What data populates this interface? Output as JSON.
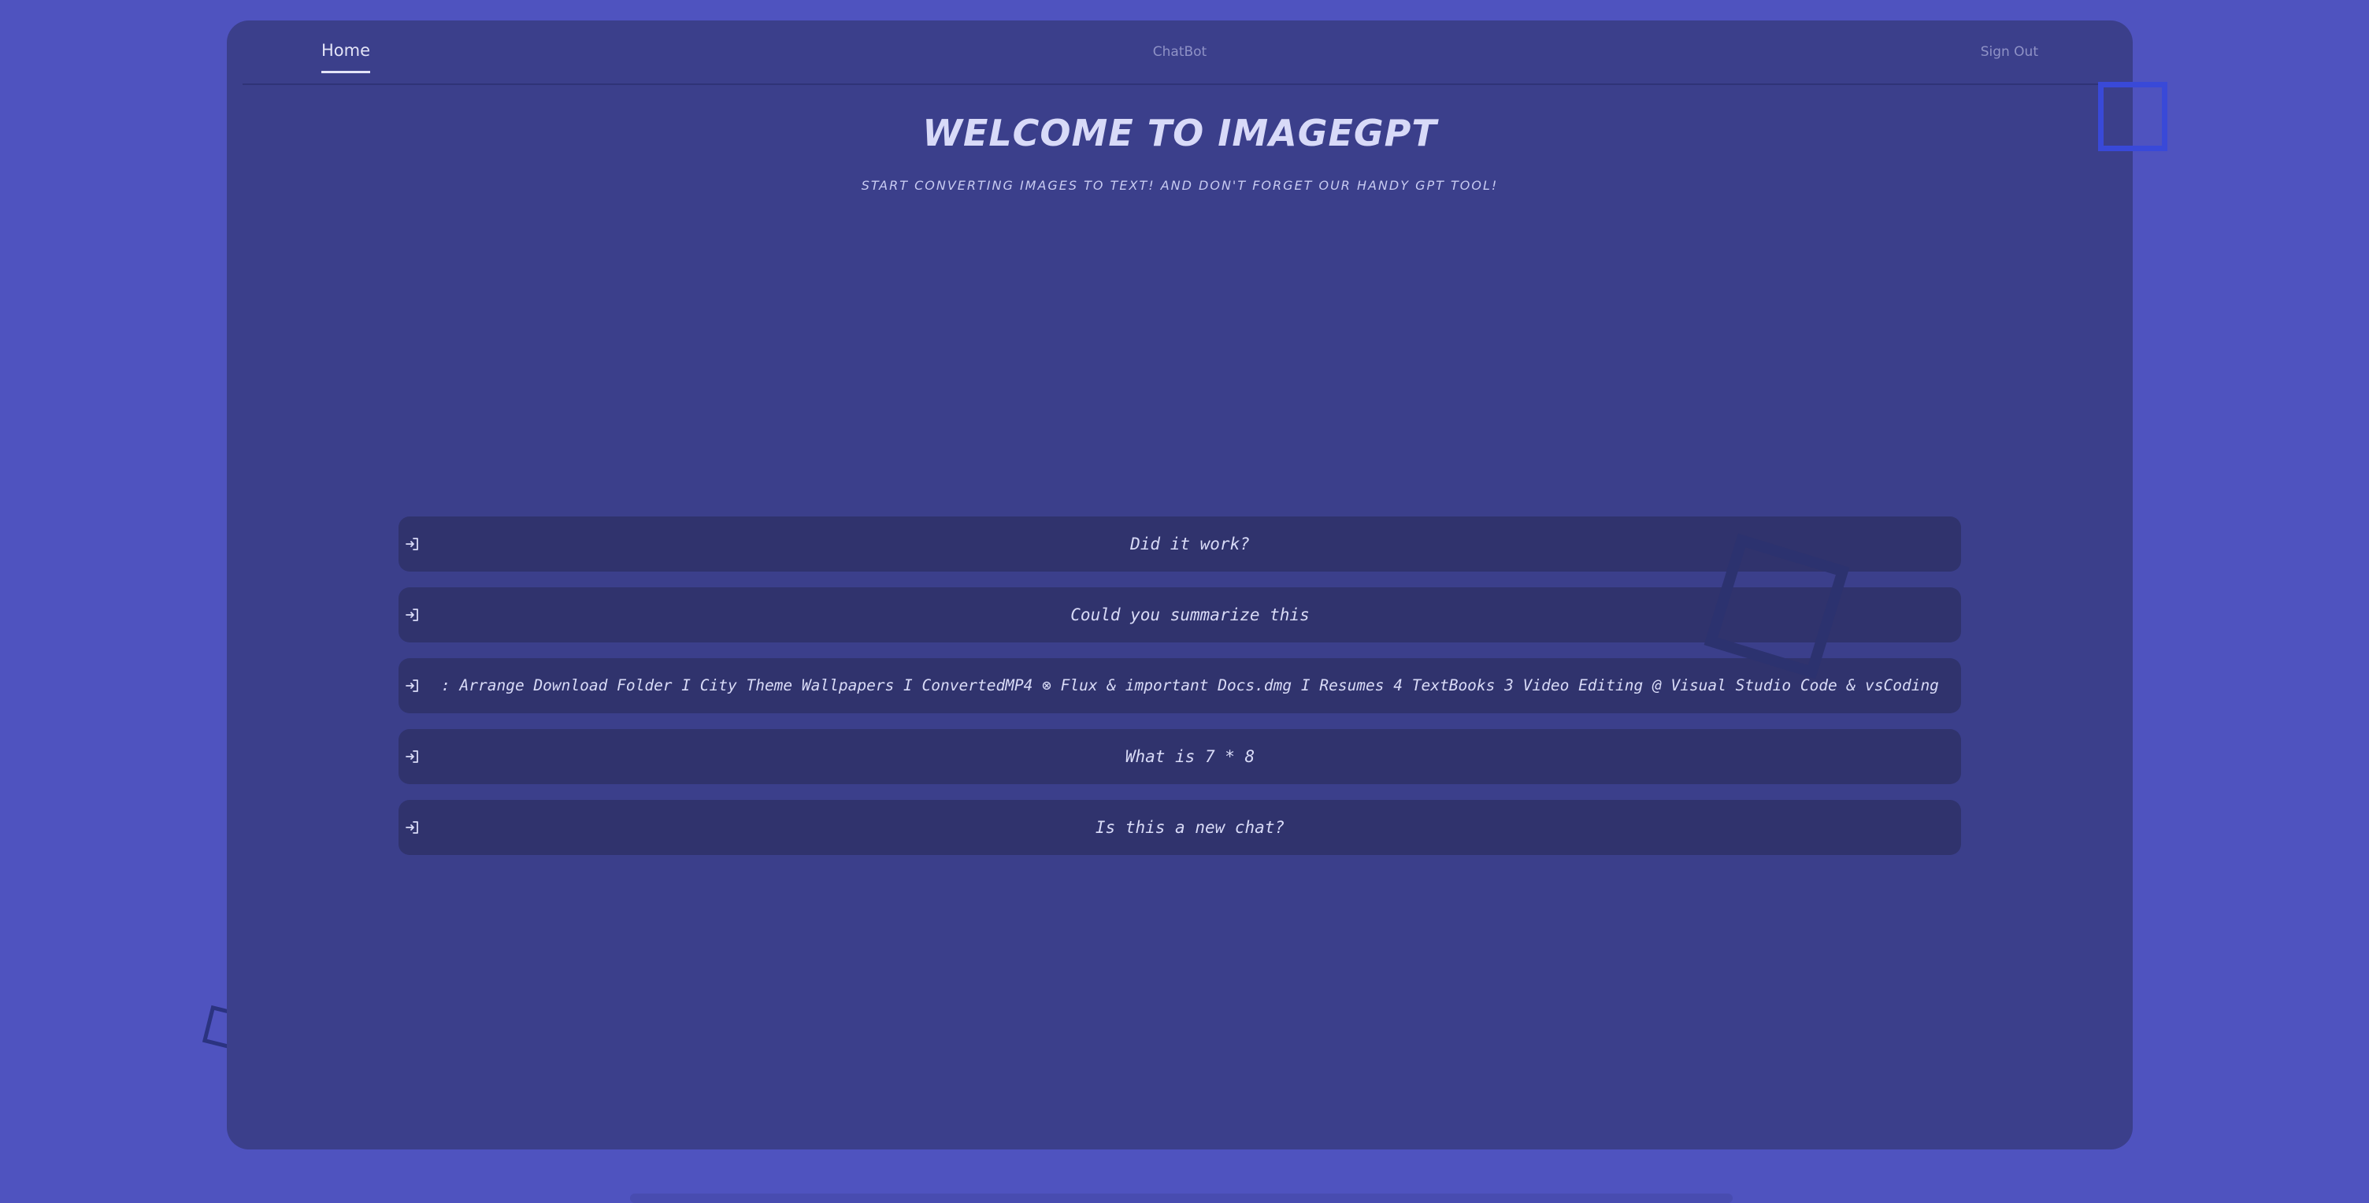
{
  "nav": {
    "home_label": "Home",
    "chatbot_label": "ChatBot",
    "signout_label": "Sign Out"
  },
  "header": {
    "title": "WELCOME TO IMAGEGPT",
    "subtitle": "START CONVERTING IMAGES TO TEXT! AND DON'T FORGET OUR HANDY GPT TOOL!"
  },
  "history": [
    {
      "text": "Did it work?",
      "icon": "login-arrow-icon"
    },
    {
      "text": "Could you summarize this",
      "icon": "login-arrow-icon"
    },
    {
      "text": ": Arrange Download Folder I City Theme Wallpapers I ConvertedMP4 ⊗ Flux & important Docs.dmg I Resumes 4 TextBooks 3 Video Editing @ Visual Studio Code & vsCoding",
      "icon": "login-arrow-icon"
    },
    {
      "text": "What is 7 * 8",
      "icon": "login-arrow-icon"
    },
    {
      "text": "Is this a new chat?",
      "icon": "login-arrow-icon"
    }
  ],
  "colors": {
    "background": "#4f53bf",
    "panel": "#3b3f8b",
    "item": "#30336d",
    "text": "#d9dbf7",
    "accent_square": "#3949d8"
  }
}
